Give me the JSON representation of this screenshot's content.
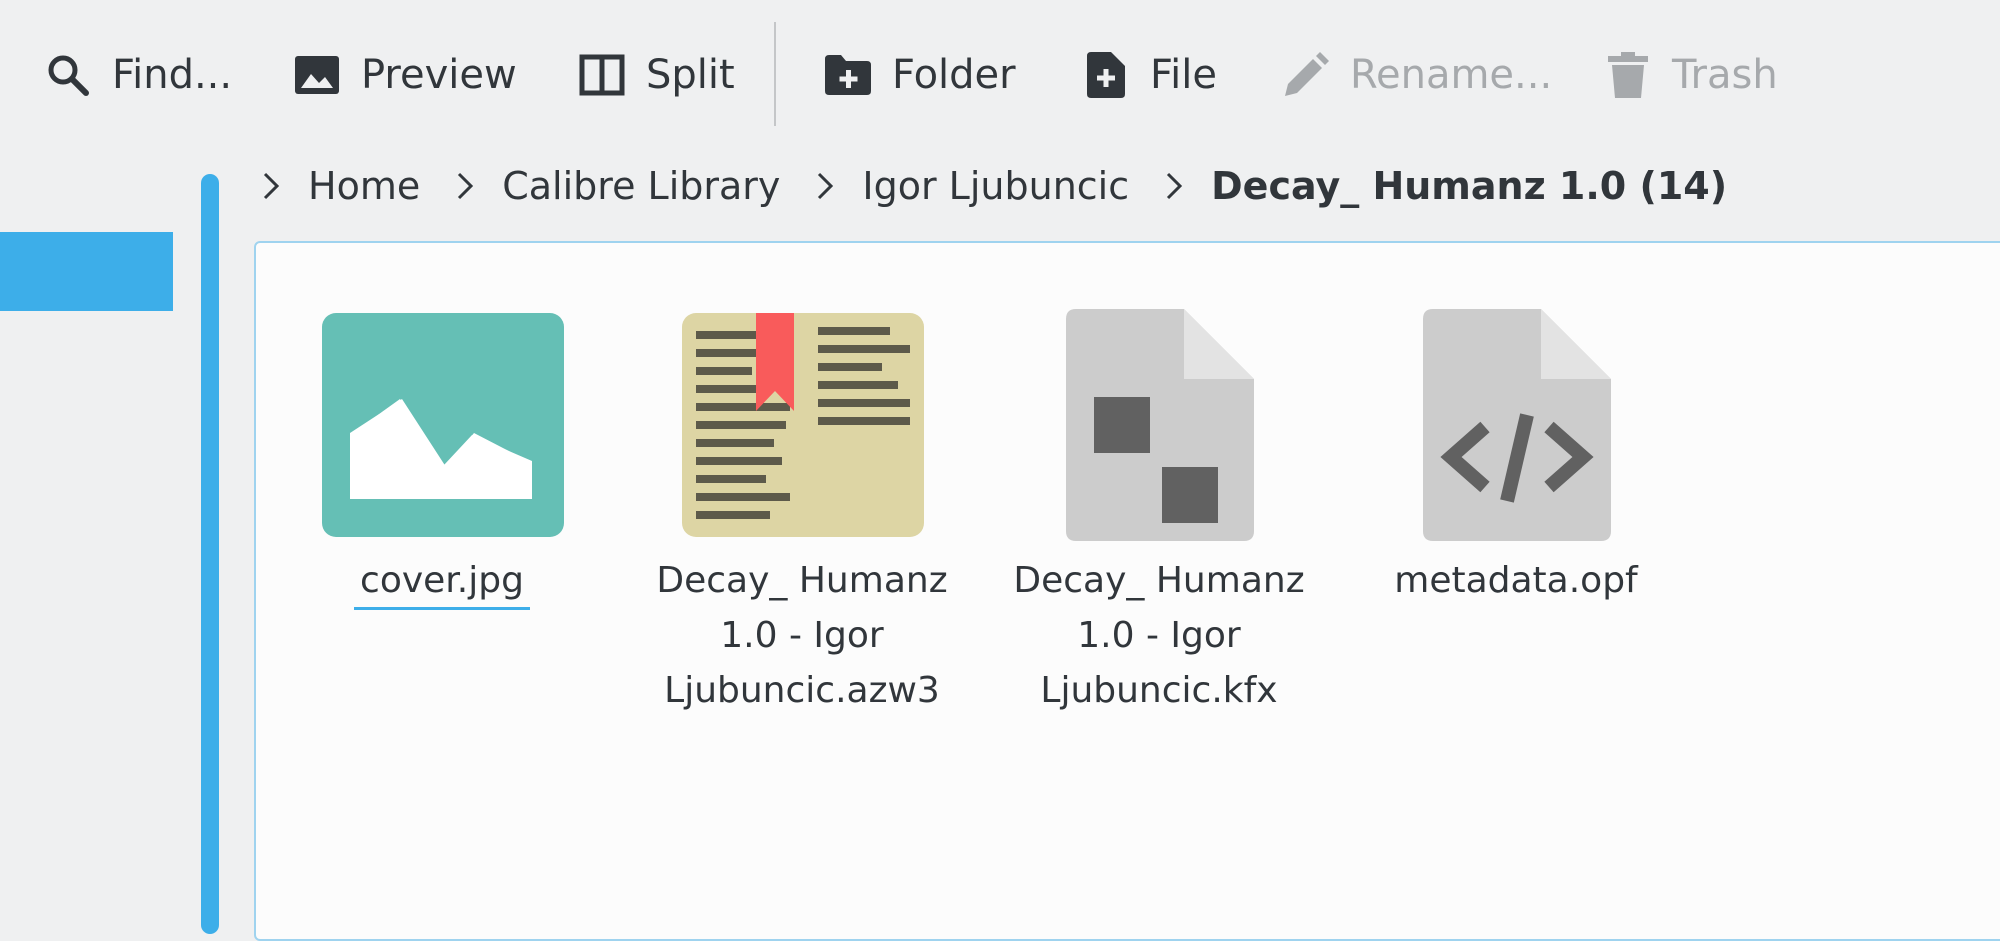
{
  "toolbar": {
    "buttons": [
      {
        "label": "Find...",
        "icon": "search-icon",
        "enabled": true
      },
      {
        "label": "Preview",
        "icon": "image-icon",
        "enabled": true
      },
      {
        "label": "Split",
        "icon": "split-view-icon",
        "enabled": true
      },
      {
        "label": "Folder",
        "icon": "new-folder-icon",
        "enabled": true
      },
      {
        "label": "File",
        "icon": "new-file-icon",
        "enabled": true
      },
      {
        "label": "Rename...",
        "icon": "pencil-icon",
        "enabled": false
      },
      {
        "label": "Trash",
        "icon": "trash-icon",
        "enabled": false
      }
    ]
  },
  "breadcrumb": {
    "items": [
      "Home",
      "Calibre Library",
      "Igor Ljubuncic",
      "Decay_ Humanz 1.0 (14)"
    ]
  },
  "files": [
    {
      "name": "cover.jpg",
      "icon": "image-file-icon",
      "focused": true
    },
    {
      "name": "Decay_ Humanz 1.0 - Igor Ljubuncic.azw3",
      "icon": "ebook-file-icon",
      "focused": false
    },
    {
      "name": "Decay_ Humanz 1.0 - Igor Ljubuncic.kfx",
      "icon": "generic-file-icon",
      "focused": false
    },
    {
      "name": "metadata.opf",
      "icon": "code-file-icon",
      "focused": false
    }
  ],
  "colors": {
    "accent": "#3daee9",
    "window_bg": "#eff0f1",
    "view_bg": "#fcfcfc",
    "text": "#31363b",
    "disabled_text": "#a6a9ac"
  }
}
